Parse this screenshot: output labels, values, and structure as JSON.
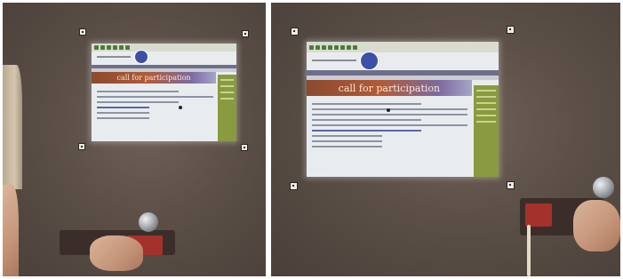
{
  "photos": [
    {
      "id": "left",
      "screen": {
        "banner_text": "call for participation"
      }
    },
    {
      "id": "right",
      "screen": {
        "banner_text": "call for participation"
      }
    }
  ],
  "colors": {
    "wall": "#5b4f47",
    "screen": "#e9ecef",
    "banner": "#b35a36",
    "sidebar": "#8a9a3f",
    "logo": "#3d4fa6"
  }
}
